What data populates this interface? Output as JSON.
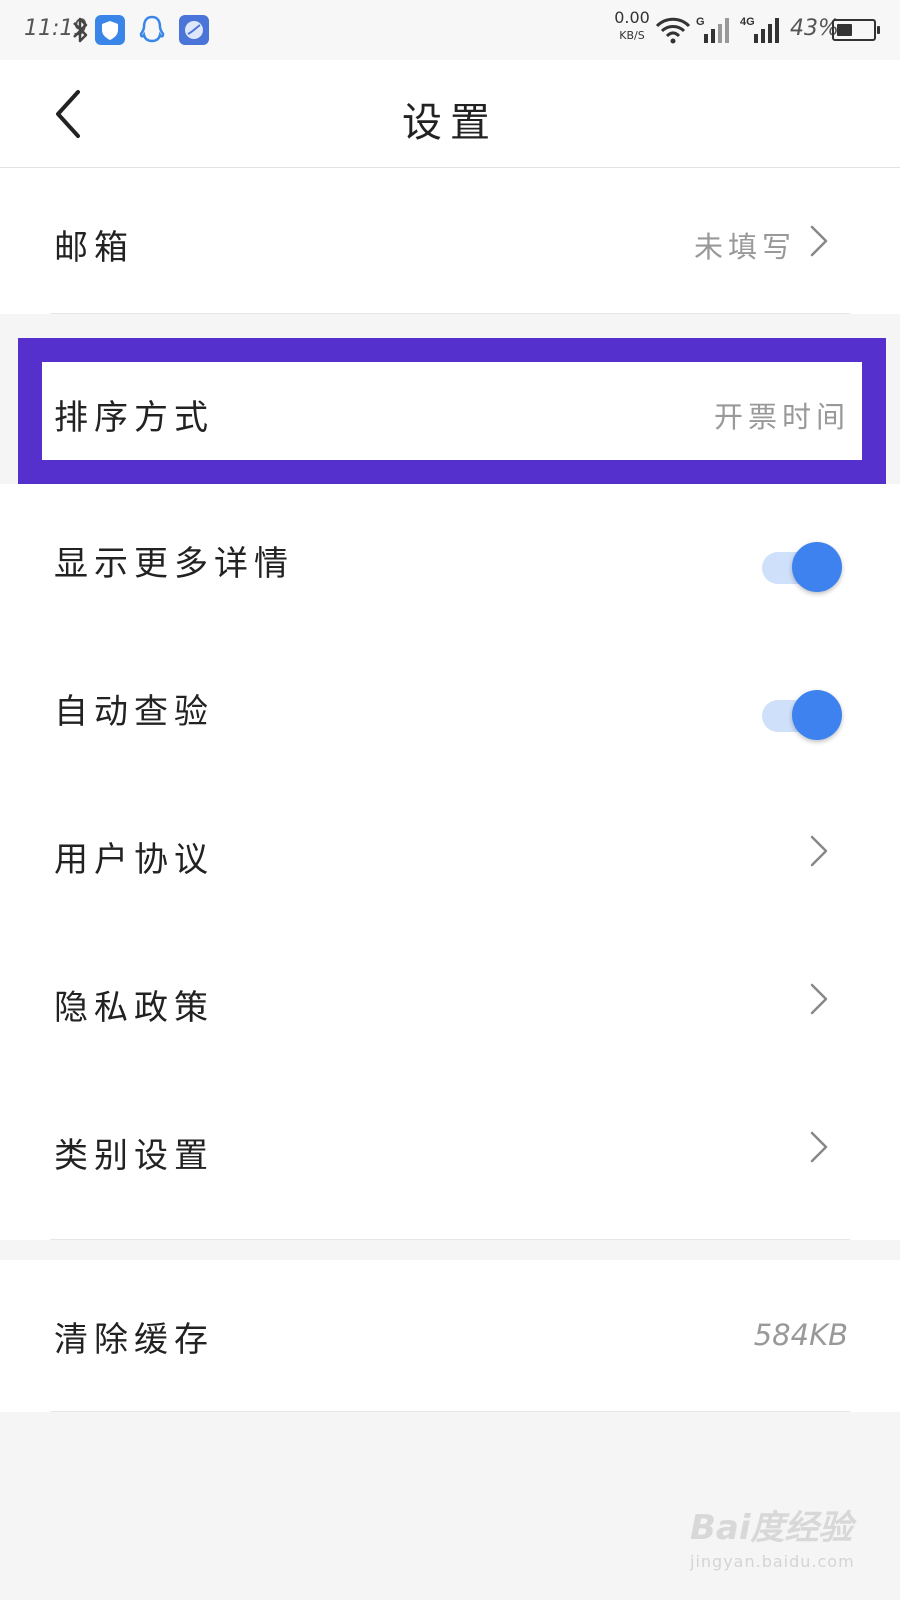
{
  "status_bar": {
    "time": "11:19",
    "speed_value": "0.00",
    "speed_unit": "KB/S",
    "network_g": "G",
    "network_4g": "4G",
    "battery_text": "43%",
    "battery_level": 0.43,
    "icons": [
      "bluetooth-icon",
      "shield-app-icon",
      "qq-icon",
      "browser-app-icon",
      "wifi-icon",
      "signal-g-icon",
      "signal-4g-icon",
      "battery-icon"
    ],
    "colors": {
      "shield_app": "#3a86e8",
      "qq": "#3a86e8",
      "browser_app": "#4a74d8"
    }
  },
  "header": {
    "title": "设置",
    "back_icon": "chevron-left-icon"
  },
  "settings": {
    "email": {
      "label": "邮箱",
      "value": "未填写"
    },
    "sort": {
      "label": "排序方式",
      "value": "开票时间"
    },
    "show_details": {
      "label": "显示更多详情",
      "enabled": true
    },
    "auto_check": {
      "label": "自动查验",
      "enabled": true
    },
    "user_agreement": {
      "label": "用户协议"
    },
    "privacy_policy": {
      "label": "隐私政策"
    },
    "category_settings": {
      "label": "类别设置"
    },
    "clear_cache": {
      "label": "清除缓存",
      "value": "584KB"
    }
  },
  "highlight_color": "#5530cc",
  "toggle_color": "#3d82ee",
  "watermark": {
    "logo": "Bai度经验",
    "url": "jingyan.baidu.com"
  }
}
